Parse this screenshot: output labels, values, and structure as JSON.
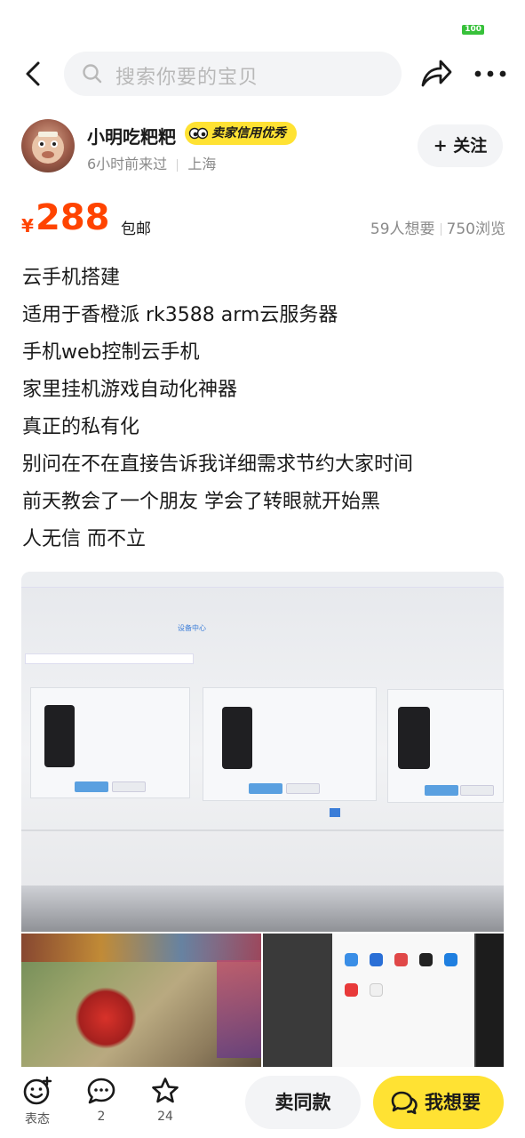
{
  "status": {
    "battery": "100"
  },
  "header": {
    "search_placeholder": "搜索你要的宝贝"
  },
  "seller": {
    "name": "小明吃粑粑",
    "badge": "卖家信用优秀",
    "last_seen": "6小时前来过",
    "location": "上海",
    "follow_label": "+ 关注"
  },
  "price": {
    "currency": "¥",
    "amount": "288",
    "shipping": "包邮",
    "wants": "59人想要",
    "views": "750浏览"
  },
  "description": [
    "云手机搭建",
    "适用于香橙派 rk3588 arm云服务器",
    "手机web控制云手机",
    "家里挂机游戏自动化神器",
    "真正的私有化",
    "别问在不在直接告诉我详细需求节约大家时间",
    "前天教会了一个朋友 学会了转眼就开始黑",
    "人无信 而不立"
  ],
  "photo": {
    "device_center": "设备中心"
  },
  "actions": {
    "react_label": "表态",
    "comments": "2",
    "favorites": "24",
    "sell_same": "卖同款",
    "want": "我想要"
  },
  "colors": {
    "price": "#ff4400",
    "accent_yellow": "#ffe233",
    "battery": "#37c13a"
  }
}
